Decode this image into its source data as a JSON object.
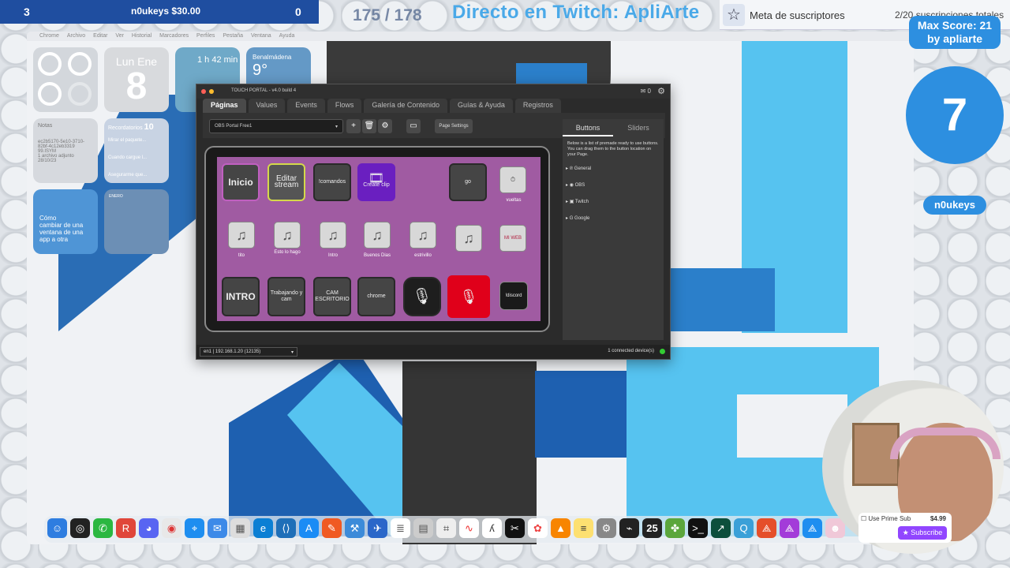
{
  "overlay": {
    "left": "3",
    "coins": "n0ukeys $30.00",
    "right": "0",
    "counter": "175 / 178",
    "title": "Directo en Twitch: ApliArte",
    "sub_goal_label": "Meta de suscriptores",
    "sub_goal_count": "2/20 suscripciones totales",
    "max_score": "Max Score: 21",
    "max_score_by": "by apliarte",
    "big_number": "7",
    "user_pill": "n0ukeys"
  },
  "menubar": [
    "Chrome",
    "Archivo",
    "Editar",
    "Ver",
    "Historial",
    "Marcadores",
    "Perfiles",
    "Pestaña",
    "Ventana",
    "Ayuda"
  ],
  "widgets": {
    "cal_day": "Lun",
    "cal_month": "Ene",
    "cal_num": "8",
    "timer": "1 h 42 min",
    "weather_city": "Benalmádena",
    "weather_temp": "9°",
    "notes_title": "Notas",
    "notes_body": "ec2b5170-5e10-3710-82bf-4c12eb3319 99.ISYM",
    "notes_meta": "1 archivo adjunto",
    "notes_date": "28/10/23",
    "remind_title": "Recordatorios",
    "remind_count": "10",
    "remind_1": "Mirar el paquete...",
    "remind_2": "Cuando cargue l...",
    "remind_3": "Asegurarme que...",
    "tip_title": "Cómo",
    "tip_body": "cambiar de una ventana de una app a otra",
    "month_name": "ENERO"
  },
  "tp": {
    "title": "TOUCH PORTAL - v4.0 build 4",
    "mail_count": "0",
    "tabs": [
      "Páginas",
      "Values",
      "Events",
      "Flows",
      "Galería de Contenido",
      "Guías & Ayuda",
      "Registros"
    ],
    "page": "OBS Portal Free1",
    "page_settings": "Page Settings",
    "side_tabs": [
      "Buttons",
      "Sliders"
    ],
    "side_desc": "Below is a list of premade ready to use buttons. You can drag them to the button location on your Page.",
    "categories": [
      "General",
      "OBS",
      "Twitch",
      "Google"
    ],
    "status_left": "en1 | 192.168.1.20 (12135)",
    "status_right": "1 connected device(s)",
    "row1": [
      "Inicio",
      "Editar stream",
      "!comandos",
      "Create clip",
      "go",
      "vueltas"
    ],
    "row2": [
      "tito",
      "Esto lo hago",
      "Intro",
      "Buenos Dias",
      "estrivillo",
      "MI WEB"
    ],
    "row3": [
      "INTRO",
      "Trabajando y cam",
      "CAM ESCRITORIO",
      "chrome",
      "!discord"
    ]
  },
  "prime": {
    "label": "Use Prime Sub",
    "price": "$4.99",
    "subscribe": "Subscribe"
  },
  "dock_badge": "25"
}
